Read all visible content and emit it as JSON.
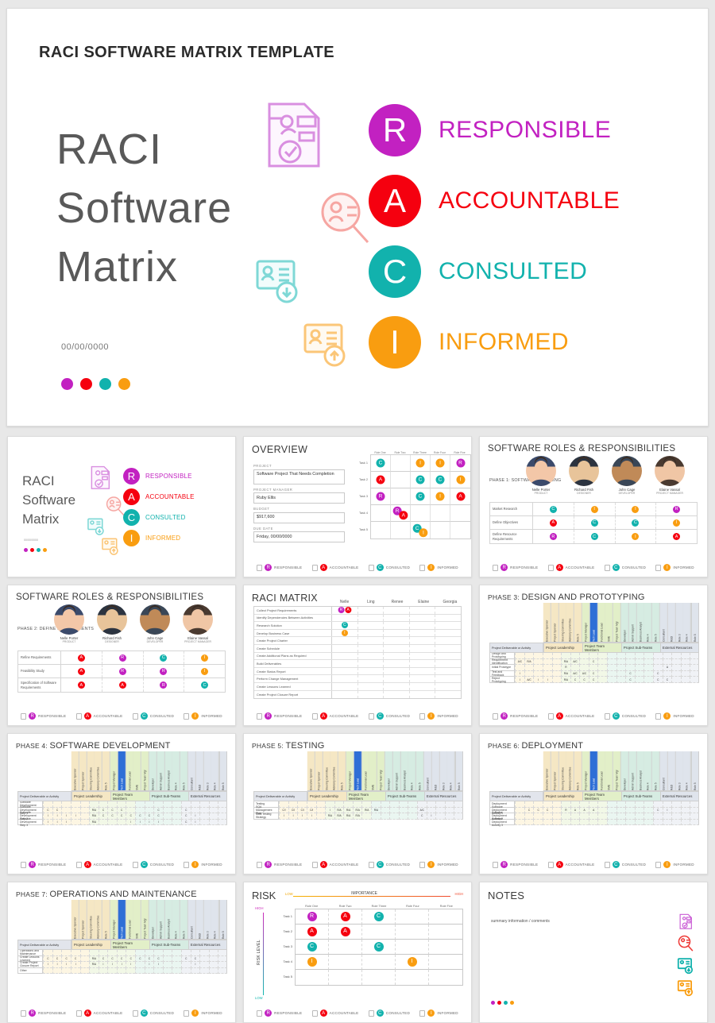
{
  "colors": {
    "responsible": "#c221c1",
    "accountable": "#f5000f",
    "consulted": "#12b2ad",
    "informed": "#f99d10",
    "title_gray": "#595959"
  },
  "hero": {
    "header": "RACI SOFTWARE MATRIX TEMPLATE",
    "title_line1": "RACI",
    "title_line2": "Software",
    "title_line3": "Matrix",
    "date": "00/00/0000",
    "legend": [
      {
        "letter": "R",
        "label": "RESPONSIBLE",
        "color": "#c221c1"
      },
      {
        "letter": "A",
        "label": "ACCOUNTABLE",
        "color": "#f5000f"
      },
      {
        "letter": "C",
        "label": "CONSULTED",
        "color": "#12b2ad"
      },
      {
        "letter": "I",
        "label": "INFORMED",
        "color": "#f99d10"
      }
    ]
  },
  "legend_strip": [
    {
      "letter": "R",
      "label": "RESPONSIBLE",
      "color": "#c221c1",
      "icon": "document-icon"
    },
    {
      "letter": "A",
      "label": "ACCOUNTABLE",
      "color": "#f5000f",
      "icon": "magnifier-icon"
    },
    {
      "letter": "C",
      "label": "CONSULTED",
      "color": "#12b2ad",
      "icon": "card-down-icon"
    },
    {
      "letter": "I",
      "label": "INFORMED",
      "color": "#f99d10",
      "icon": "card-up-icon"
    }
  ],
  "card_title_slide": {
    "title_line1": "RACI",
    "title_line2": "Software",
    "title_line3": "Matrix",
    "date": "00/00/0000"
  },
  "overview": {
    "title": "OVERVIEW",
    "fields": [
      {
        "label": "PROJECT",
        "value": "Software Project That Needs Completion"
      },
      {
        "label": "PROJECT MANAGER",
        "value": "Ruby Ellis"
      },
      {
        "label": "BUDGET",
        "value": "$917,600"
      },
      {
        "label": "DUE DATE",
        "value": "Friday, 00/00/0000"
      }
    ],
    "columns": [
      "Role One",
      "Role Two",
      "Role Three",
      "Role Four",
      "Role Five"
    ],
    "rows": [
      "Task 1",
      "Task 2",
      "Task 3",
      "Task 4",
      "Task 5"
    ],
    "cells": [
      [
        "C",
        "",
        "I",
        "I",
        "R"
      ],
      [
        "A",
        "",
        "C",
        "C",
        "I"
      ],
      [
        "R",
        "",
        "C",
        "I",
        "A"
      ],
      [
        "",
        "RA",
        "",
        "",
        ""
      ],
      [
        "",
        "",
        "CI",
        "",
        ""
      ]
    ]
  },
  "roles_phase1": {
    "title": "SOFTWARE ROLES & RESPONSIBILITIES",
    "phase": "PHASE 1: SOFTWARE PLANNING",
    "people": [
      {
        "name": "Nelle Porter",
        "role": "PRODUCT"
      },
      {
        "name": "Richard Fish",
        "role": "DESIGNER"
      },
      {
        "name": "John Cage",
        "role": "DEVELOPER"
      },
      {
        "name": "Elaine Vassal",
        "role": "PROJECT MANAGER"
      }
    ],
    "rows": [
      {
        "label": "Market Research",
        "values": [
          "C",
          "I",
          "I",
          "R"
        ]
      },
      {
        "label": "Define Objectives",
        "values": [
          "A",
          "C",
          "C",
          "I"
        ]
      },
      {
        "label": "Define Resource Requirements",
        "values": [
          "R",
          "C",
          "I",
          "A"
        ]
      }
    ]
  },
  "roles_phase2": {
    "title": "SOFTWARE ROLES & RESPONSIBILITIES",
    "phase": "PHASE 2: DEFINE REQUIREMENTS",
    "people": [
      {
        "name": "Nelle Porter",
        "role": "PRODUCT"
      },
      {
        "name": "Richard Fish",
        "role": "DESIGNER"
      },
      {
        "name": "John Cage",
        "role": "DEVELOPER"
      },
      {
        "name": "Elaine Vassal",
        "role": "PROJECT MANAGER"
      }
    ],
    "rows": [
      {
        "label": "Refine Requirements",
        "values": [
          "A",
          "R",
          "C",
          "I"
        ]
      },
      {
        "label": "Feasibility Study",
        "values": [
          "A",
          "R",
          "R",
          "I"
        ]
      },
      {
        "label": "Specification of Software Requirements",
        "values": [
          "A",
          "A",
          "R",
          "C"
        ]
      }
    ]
  },
  "raci_matrix": {
    "title": "RACI MATRIX",
    "columns": [
      "Nelle",
      "Ling",
      "Renee",
      "Elaine",
      "Georgia"
    ],
    "rows": [
      {
        "label": "Collect Project Requirements",
        "values": [
          "RA",
          "",
          "",
          "",
          ""
        ]
      },
      {
        "label": "Identify Dependencies Between Activities",
        "values": [
          "",
          "",
          "",
          "",
          ""
        ]
      },
      {
        "label": "Research Solution",
        "values": [
          "C",
          "",
          "",
          "",
          ""
        ]
      },
      {
        "label": "Develop Business Case",
        "values": [
          "I",
          "",
          "",
          "",
          ""
        ]
      },
      {
        "label": "Create Project Charter",
        "values": [
          "",
          "",
          "",
          "",
          ""
        ]
      },
      {
        "label": "Create Schedule",
        "values": [
          "",
          "",
          "",
          "",
          ""
        ]
      },
      {
        "label": "Create Additional Plans as Required",
        "values": [
          "",
          "",
          "",
          "",
          ""
        ]
      },
      {
        "label": "Build Deliverables",
        "values": [
          "",
          "",
          "",
          "",
          ""
        ]
      },
      {
        "label": "Create Status Report",
        "values": [
          "",
          "",
          "",
          "",
          ""
        ]
      },
      {
        "label": "Perform Change Management",
        "values": [
          "",
          "",
          "",
          "",
          ""
        ]
      },
      {
        "label": "Create Lessons Learned",
        "values": [
          "",
          "",
          "",
          "",
          ""
        ]
      },
      {
        "label": "Create Project Closure Report",
        "values": [
          "",
          "",
          "",
          "",
          ""
        ]
      }
    ]
  },
  "phase_matrix_common": {
    "deliverable_header": "Project Deliverable or Activity",
    "groups": [
      {
        "name": "Project Leadership",
        "span": 5,
        "color": "#f5e7c4"
      },
      {
        "name": "Project Team Members",
        "span": 5,
        "color": "#e2efc8"
      },
      {
        "name": "Project Sub-Teams",
        "span": 5,
        "color": "#d6ece2"
      },
      {
        "name": "External Resources",
        "span": 5,
        "color": "#dfe4ec"
      }
    ],
    "columns": [
      "Executive Sponsor",
      "Project Sponsor",
      "Steering Committee",
      "Advisory Committee",
      "Role 5",
      "Project Manager",
      "Tech Lead",
      "Functional Lead",
      "SME",
      "Project Team Mgr",
      "Developer",
      "Admin Support",
      "Business Analyst",
      "Role 4",
      "Role 5",
      "Consultant",
      "R&D",
      "Role 3",
      "Role 4",
      "Role 5"
    ]
  },
  "phase3": {
    "title_prefix": "PHASE 3: ",
    "title": "DESIGN AND PROTOTYPING",
    "rows": [
      {
        "label": "Design and Prototyping",
        "values": [
          "",
          "",
          "",
          "",
          "",
          "",
          "",
          "",
          "",
          "",
          "",
          "",
          "",
          "",
          "",
          "",
          "",
          "",
          "",
          ""
        ]
      },
      {
        "label": "Requirement Identification",
        "values": [
          "A/C",
          "R/A",
          "",
          "",
          "",
          "R/A",
          "A/C",
          "",
          "C",
          "",
          "",
          "",
          "",
          "",
          "",
          "",
          "",
          "",
          "",
          ""
        ]
      },
      {
        "label": "Initial Prototype",
        "values": [
          "",
          "",
          "",
          "",
          "",
          "R",
          "",
          "",
          "",
          "",
          "",
          "",
          "",
          "",
          "",
          "",
          "A",
          "",
          "",
          ""
        ]
      },
      {
        "label": "Test and Feedback",
        "values": [
          "I",
          "",
          "",
          "",
          "",
          "R/A",
          "A/C",
          "A/C",
          "C",
          "",
          "",
          "",
          "C",
          "",
          "",
          "C",
          "",
          "",
          "",
          ""
        ]
      },
      {
        "label": "Reject Prototyping",
        "values": [
          "I",
          "A/C",
          "I",
          "I",
          "",
          "R/A",
          "C",
          "C",
          "C",
          "",
          "",
          "",
          "C",
          "",
          "",
          "C",
          "C",
          "",
          "",
          ""
        ]
      }
    ]
  },
  "phase4": {
    "title_prefix": "PHASE 4: ",
    "title": "SOFTWARE DEVELOPMENT",
    "rows": [
      {
        "label": "Software Development",
        "values": [
          "",
          "",
          "",
          "",
          "",
          "",
          "",
          "",
          "",
          "",
          "",
          "",
          "",
          "",
          "",
          "",
          "",
          "",
          "",
          ""
        ]
      },
      {
        "label": "Software Development Step 1",
        "values": [
          "C",
          "C",
          "",
          "",
          "",
          "R/A",
          "C",
          "C",
          "C",
          "",
          "",
          "",
          "C",
          "",
          "",
          "C",
          "",
          "",
          "",
          ""
        ]
      },
      {
        "label": "Software Development Step 2",
        "values": [
          "I",
          "I",
          "I",
          "I",
          "",
          "R/A",
          "C",
          "C",
          "C",
          "C",
          "C",
          "C",
          "C",
          "",
          "",
          "C",
          "I",
          "",
          "",
          ""
        ]
      },
      {
        "label": "Software Development Step 3",
        "values": [
          "I",
          "I",
          "I",
          "",
          "",
          "R/A",
          "",
          "",
          "",
          "I",
          "I",
          "I",
          "I",
          "",
          "",
          "C",
          "I",
          "",
          "",
          ""
        ]
      }
    ]
  },
  "phase5": {
    "title_prefix": "PHASE 5: ",
    "title": "TESTING",
    "rows": [
      {
        "label": "Testing",
        "values": [
          "",
          "",
          "",
          "",
          "",
          "",
          "",
          "",
          "",
          "",
          "",
          "",
          "",
          "",
          "",
          "",
          "",
          "",
          "",
          ""
        ]
      },
      {
        "label": "SQA Management Plan",
        "values": [
          "C/I",
          "C/I",
          "C/I",
          "C/I",
          "",
          "I",
          "R/A",
          "R/A",
          "R/A",
          "R/A",
          "R/A",
          "",
          "",
          "",
          "",
          "A/C",
          "",
          "",
          "",
          ""
        ]
      },
      {
        "label": "Multi Testing Strategy",
        "values": [
          "I",
          "I",
          "I",
          "I",
          "",
          "R/A",
          "R/A",
          "R/A",
          "R/A",
          "",
          "",
          "",
          "",
          "",
          "",
          "C",
          "I",
          "",
          "",
          ""
        ]
      }
    ]
  },
  "phase6": {
    "title_prefix": "PHASE 6: ",
    "title": "DEPLOYMENT",
    "rows": [
      {
        "label": "Deployment",
        "values": [
          "",
          "",
          "",
          "",
          "",
          "",
          "",
          "",
          "",
          "",
          "",
          "",
          "",
          "",
          "",
          "",
          "",
          "",
          "",
          ""
        ]
      },
      {
        "label": "Software Deployment Activity 1",
        "values": [
          "",
          "C",
          "C",
          "C",
          "",
          "R",
          "A",
          "A",
          "A",
          "",
          "",
          "",
          "",
          "",
          "",
          "C",
          "I",
          "",
          "",
          ""
        ]
      },
      {
        "label": "Software Deployment Activity 2",
        "values": [
          "",
          "",
          "",
          "",
          "",
          "",
          "",
          "",
          "",
          "",
          "",
          "",
          "",
          "",
          "",
          "",
          "",
          "",
          "",
          ""
        ]
      },
      {
        "label": "Software Deployment Activity 3",
        "values": [
          "",
          "",
          "",
          "",
          "",
          "",
          "",
          "",
          "",
          "",
          "",
          "",
          "",
          "",
          "",
          "",
          "",
          "",
          "",
          ""
        ]
      }
    ]
  },
  "phase7": {
    "title_prefix": "PHASE 7: ",
    "title": "OPERATIONS AND MAINTENANCE",
    "rows": [
      {
        "label": "Operations and Maintenance",
        "values": [
          "",
          "",
          "",
          "",
          "",
          "",
          "",
          "",
          "",
          "",
          "",
          "",
          "",
          "",
          "",
          "",
          "",
          "",
          "",
          ""
        ]
      },
      {
        "label": "Create Lessons Learned",
        "values": [
          "C",
          "C",
          "C",
          "C",
          "",
          "R/A",
          "C",
          "C",
          "C",
          "C",
          "C",
          "C",
          "C",
          "",
          "",
          "C",
          "C",
          "",
          "",
          ""
        ]
      },
      {
        "label": "Create Project Closure Report",
        "values": [
          "I",
          "I",
          "I",
          "I",
          "",
          "R/A",
          "I",
          "I",
          "I",
          "I",
          "",
          "I",
          "I",
          "",
          "",
          "",
          "I",
          "",
          "",
          ""
        ]
      },
      {
        "label": "Other",
        "values": [
          "",
          "",
          "",
          "",
          "",
          "",
          "",
          "",
          "",
          "",
          "",
          "",
          "",
          "",
          "",
          "",
          "",
          "",
          "",
          ""
        ]
      }
    ]
  },
  "risk": {
    "title": "RISK",
    "axis_x_low": "LOW",
    "axis_x_label": "IMPORTANCE",
    "axis_x_high": "HIGH",
    "axis_y_high": "HIGH",
    "axis_y_label": "RISK LEVEL",
    "axis_y_low": "LOW",
    "columns": [
      "Role One",
      "Role Two",
      "Role Three",
      "Role Four",
      "Role Five"
    ],
    "rows": [
      "Task 1",
      "Task 2",
      "Task 3",
      "Task 4",
      "Task 5"
    ],
    "cells": [
      [
        "R",
        "A",
        "C",
        "",
        ""
      ],
      [
        "A",
        "A",
        "",
        "",
        ""
      ],
      [
        "C",
        "",
        "C",
        "",
        ""
      ],
      [
        "I",
        "",
        "",
        "I",
        ""
      ],
      [
        "",
        "",
        "",
        "",
        ""
      ]
    ]
  },
  "notes": {
    "title": "NOTES",
    "text": "summary information / comments"
  }
}
